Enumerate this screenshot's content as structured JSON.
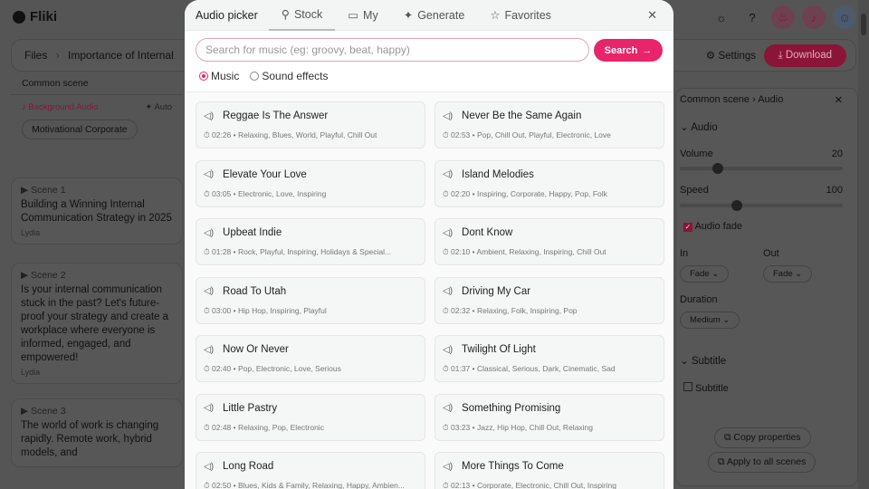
{
  "app": {
    "name": "Fliki"
  },
  "header": {
    "icons": [
      "sun-icon",
      "help-icon",
      "fire-icon",
      "bell-icon",
      "user-icon"
    ]
  },
  "breadcrumb": {
    "root": "Files",
    "sep": "›",
    "current": "Importance of Internal"
  },
  "toolbar": {
    "settings": "Settings",
    "download": "Download"
  },
  "common_scene": {
    "title": "Common scene",
    "bg_audio_label": "Background Audio",
    "auto_label": "Auto",
    "audio_chip": "Motivational Corporate"
  },
  "scenes": [
    {
      "label": "Scene 1",
      "text": "Building a Winning Internal Communication Strategy in 2025",
      "voice": "Lydia"
    },
    {
      "label": "Scene 2",
      "text": "Is your internal communication stuck in the past? Let's future-proof your strategy and create a workplace where everyone is informed, engaged, and empowered!",
      "voice": "Lydia"
    },
    {
      "label": "Scene 3",
      "text": "The world of work is changing rapidly. Remote work, hybrid models, and"
    }
  ],
  "properties": {
    "breadcrumb": "Common scene  ›  Audio",
    "section_audio": "Audio",
    "volume_label": "Volume",
    "volume": 20,
    "speed_label": "Speed",
    "speed": 100,
    "audio_fade": "Audio fade",
    "in_label": "In",
    "in_value": "Fade",
    "out_label": "Out",
    "out_value": "Fade",
    "duration_label": "Duration",
    "duration_value": "Medium",
    "section_subtitle": "Subtitle",
    "subtitle_check": "Subtitle",
    "copy": "Copy properties",
    "apply": "Apply to all scenes"
  },
  "picker": {
    "title": "Audio picker",
    "tabs": [
      {
        "label": "Stock",
        "icon": "search-icon",
        "active": true
      },
      {
        "label": "My",
        "icon": "folder-icon"
      },
      {
        "label": "Generate",
        "icon": "sparkle-icon"
      },
      {
        "label": "Favorites",
        "icon": "star-icon"
      }
    ],
    "search_placeholder": "Search for music (eg: groovy, beat, happy)",
    "search_value": "",
    "search_button": "Search",
    "types": [
      {
        "label": "Music",
        "selected": true
      },
      {
        "label": "Sound effects",
        "selected": false
      }
    ],
    "accent": "#e8246a",
    "tracks": [
      {
        "title": "Reggae Is The Answer",
        "meta": "02:26 • Relaxing, Blues, World, Playful, Chill Out"
      },
      {
        "title": "Never Be the Same Again",
        "meta": "02:53 • Pop, Chill Out, Playful, Electronic, Love"
      },
      {
        "title": "Elevate Your Love",
        "meta": "03:05 • Electronic, Love, Inspiring"
      },
      {
        "title": "Island Melodies",
        "meta": "02:20 • Inspiring, Corporate, Happy, Pop, Folk"
      },
      {
        "title": "Upbeat Indie",
        "meta": "01:28 • Rock, Playful, Inspiring, Holidays & Special..."
      },
      {
        "title": "Dont Know",
        "meta": "02:10 • Ambient, Relaxing, Inspiring, Chill Out"
      },
      {
        "title": "Road To Utah",
        "meta": "03:00 • Hip Hop, Inspiring, Playful"
      },
      {
        "title": "Driving My Car",
        "meta": "02:32 • Relaxing, Folk, Inspiring, Pop"
      },
      {
        "title": "Now Or Never",
        "meta": "02:40 • Pop, Electronic, Love, Serious"
      },
      {
        "title": "Twilight Of Light",
        "meta": "01:37 • Classical, Serious, Dark, Cinematic, Sad"
      },
      {
        "title": "Little Pastry",
        "meta": "02:48 • Relaxing, Pop, Electronic"
      },
      {
        "title": "Something Promising",
        "meta": "03:23 • Jazz, Hip Hop, Chill Out, Relaxing"
      },
      {
        "title": "Long Road",
        "meta": "02:50 • Blues, Kids & Family, Relaxing, Happy, Ambien..."
      },
      {
        "title": "More Things To Come",
        "meta": "02:13 • Corporate, Electronic, Chill Out, Inspiring"
      }
    ]
  }
}
